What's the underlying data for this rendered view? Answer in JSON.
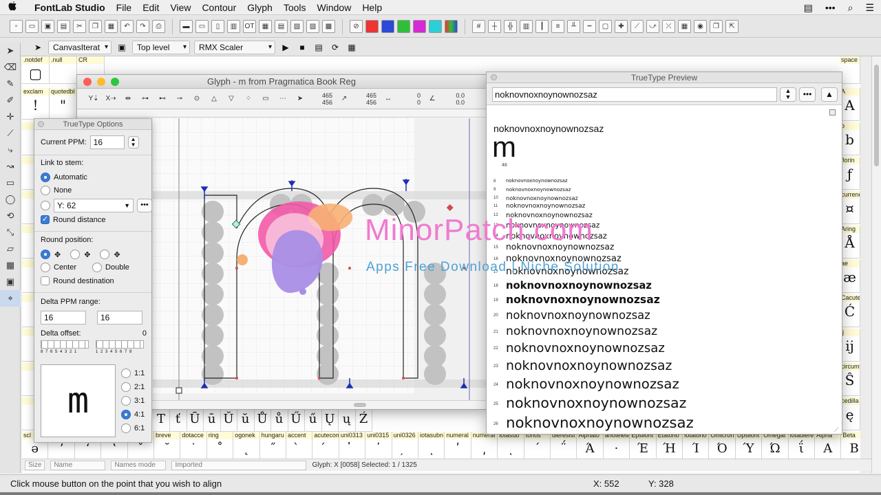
{
  "menubar": {
    "apple": "",
    "app": "FontLab Studio",
    "items": [
      "File",
      "Edit",
      "View",
      "Contour",
      "Glyph",
      "Tools",
      "Window",
      "Help"
    ]
  },
  "toolbar2": {
    "tool_select": "CanvasIterat",
    "level_select": "Top level",
    "scaler_select": "RMX Scaler"
  },
  "fontwindow": {
    "top_row_names": [
      ".notdef",
      ".null",
      "CR",
      "",
      "",
      "",
      "",
      "",
      "",
      "",
      "",
      "",
      "",
      "",
      "",
      "",
      "",
      "",
      "",
      "",
      "",
      "",
      "",
      "",
      "",
      "",
      "",
      "",
      "",
      "space"
    ],
    "row2_names": [
      "exclam",
      "quotedbl"
    ],
    "row2_glyphs": [
      "!",
      "\""
    ],
    "left_col_names": [
      "",
      "",
      "quo",
      "",
      "",
      "",
      "",
      "",
      "",
      "",
      "",
      "",
      "",
      ""
    ],
    "row_glyph_cells": [
      {
        "names": [
          "",
          "",
          "",
          "",
          "T",
          "ť",
          "Ū",
          "ū",
          "Ŭ",
          "ŭ",
          "Ů",
          "ů",
          "Ű",
          "ű",
          "Ų",
          "ų",
          "Ź"
        ],
        "glyphs": [
          "",
          "",
          "",
          "",
          "T",
          "ť",
          "Ū",
          "ū",
          "Ŭ",
          "ŭ",
          "Ů",
          "ů",
          "Ű",
          "ű",
          "Ų",
          "ų",
          "Ź"
        ]
      },
      {
        "names": [
          "scl",
          "",
          "",
          "",
          "caron",
          "breve",
          "dotacce",
          "ring",
          "ogonek",
          "hungaru",
          "accent",
          "acutecom",
          "uni0313",
          "uni0315",
          "uni0326",
          "iotasubn",
          "numeral",
          "numeral",
          "iotasub",
          "tonos",
          "dieresist",
          "Alphato",
          "anoteleia",
          "Epsilont",
          "Etatono",
          "Iotatono",
          "Omicron",
          "Upsilont",
          "Omegat",
          "iotadiere",
          "Alpha",
          "Beta"
        ],
        "glyphs": [
          "ə",
          "ʼ",
          "ʻ",
          "ʽ",
          "ˇ",
          "˘",
          "˙",
          "˚",
          "˛",
          "˝",
          "̀",
          "́",
          "̓",
          "̕",
          "̦",
          "ͺ",
          "ʹ",
          "͵",
          "ͺ",
          "΄",
          "΅",
          "Ά",
          "·",
          "Έ",
          "Ή",
          "Ί",
          "Ό",
          "Ύ",
          "Ώ",
          "ΐ",
          "Α",
          "Β"
        ]
      }
    ],
    "right_col": [
      {
        "name": "A",
        "glyph": "A"
      },
      {
        "name": "b",
        "glyph": "b"
      },
      {
        "name": "florin",
        "glyph": "ƒ"
      },
      {
        "name": "currency",
        "glyph": "¤"
      },
      {
        "name": "Aring",
        "glyph": "Å"
      },
      {
        "name": "ae",
        "glyph": "æ"
      },
      {
        "name": "Cacute",
        "glyph": "Ć"
      },
      {
        "name": "ij",
        "glyph": "ij"
      },
      {
        "name": "circumf",
        "glyph": "Ŝ"
      },
      {
        "name": "cedilla",
        "glyph": "ę"
      }
    ],
    "filter": {
      "size": "Size",
      "names": "Name",
      "names_mode": "Names mode",
      "imported": "Imported",
      "glyph_info": "Glyph: X [0058]  Selected: 1 / 1325"
    }
  },
  "status": {
    "message": "Click mouse button on the point that you wish to align",
    "x": "X: 552",
    "y": "Y: 328"
  },
  "glyph_window": {
    "title": "Glyph - m from Pragmatica Book Reg",
    "coords": {
      "a1": "465",
      "a2": "456",
      "b1": "465",
      "b2": "456",
      "c1": "0",
      "c2": "0",
      "d1": "0.0",
      "d2": "0.0"
    }
  },
  "tt_options": {
    "title": "TrueType Options",
    "current_ppm_label": "Current PPM:",
    "current_ppm_value": "16",
    "link_to_stem_label": "Link to stem:",
    "automatic": "Automatic",
    "none": "None",
    "y_value": "Y: 62",
    "round_distance": "Round distance",
    "round_position_label": "Round position:",
    "center": "Center",
    "double": "Double",
    "round_destination": "Round destination",
    "delta_ppm_label": "Delta PPM range:",
    "delta_from": "16",
    "delta_to": "16",
    "delta_offset_label": "Delta offset:",
    "delta_offset_value": "0",
    "neg_scale": "8 7 6 5 4 3 2 1",
    "pos_scale": "1 2 3 4 5 6 7 8",
    "preview_glyph": "m",
    "zoom_options": [
      "1:1",
      "2:1",
      "3:1",
      "4:1",
      "6:1"
    ],
    "zoom_selected": "4:1"
  },
  "tt_preview": {
    "title": "TrueType Preview",
    "sample_text": "noknovnoxnoynownozsaz",
    "header_text": "noknovnoxnoynownozsaz",
    "big_glyph": "m",
    "big_size": "48",
    "lines": [
      {
        "size": "8",
        "text": "noknovnoxnoynownozsaz"
      },
      {
        "size": "9",
        "text": "noknovnoxnoynownozsaz"
      },
      {
        "size": "10",
        "text": "noknovnoxnoynownozsaz"
      },
      {
        "size": "11",
        "text": "noknovnoxnoynownozsaz"
      },
      {
        "size": "12",
        "text": "noknovnoxnoynownozsaz"
      },
      {
        "size": "13",
        "text": "noknovnoxnoynownozsaz"
      },
      {
        "size": "14",
        "text": "noknovnoxnoynownozsaz"
      },
      {
        "size": "15",
        "text": "noknovnoxnoynownozsaz"
      },
      {
        "size": "16",
        "text": "noknovnoxnoynownozsaz"
      },
      {
        "size": "17",
        "text": "noknovnoxnoynownozsaz"
      },
      {
        "size": "18",
        "text": "noknovnoxnoynownozsaz"
      },
      {
        "size": "19",
        "text": "noknovnoxnoynownozsaz"
      },
      {
        "size": "20",
        "text": "noknovnoxnoynownozsaz"
      },
      {
        "size": "21",
        "text": "noknovnoxnoynownozsaz"
      },
      {
        "size": "22",
        "text": "noknovnoxnoynownozsaz"
      },
      {
        "size": "23",
        "text": "noknovnoxnoynownozsaz"
      },
      {
        "size": "24",
        "text": "noknovnoxnoynownozsaz"
      },
      {
        "size": "25",
        "text": "noknovnoxnoynownozsaz"
      },
      {
        "size": "26",
        "text": "noknovnoxnoynownozsaz"
      }
    ]
  },
  "watermark": {
    "title": "MinorPatch.com",
    "subtitle": "Apps Free Download | Niche Solution"
  },
  "colors": {
    "accent": "#3a7bd5",
    "cell_name_bg": "#fffbd6",
    "watermark_pink": "#f07ad0",
    "watermark_blue": "#4ea1d6"
  }
}
